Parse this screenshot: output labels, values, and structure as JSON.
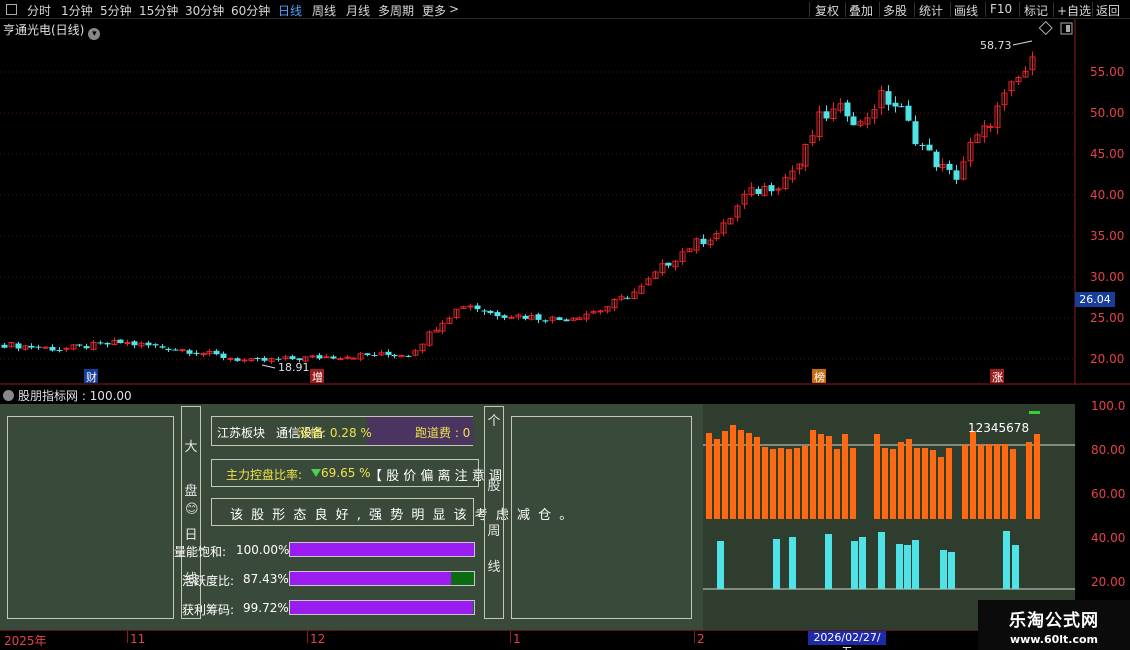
{
  "toolbar": {
    "left": [
      "分时",
      "1分钟",
      "5分钟",
      "15分钟",
      "30分钟",
      "60分钟",
      "日线",
      "周线",
      "月线",
      "多周期",
      "更多"
    ],
    "more_arrow": ">",
    "right": [
      "复权",
      "叠加",
      "多股",
      "统计",
      "画线",
      "F10",
      "标记",
      "+自选",
      "返回"
    ]
  },
  "main": {
    "title": "亨通光电(日线)",
    "high_label": "58.73",
    "low_label": "18.91",
    "last_price": "26.04",
    "yaxis": [
      "55.00",
      "50.00",
      "45.00",
      "40.00",
      "35.00",
      "30.00",
      "25.00",
      "20.00"
    ],
    "markers": [
      "财",
      "增",
      "榜",
      "涨"
    ],
    "up_color": "#e8232b",
    "down_color": "#4fe3e8"
  },
  "indicator": {
    "title": "股朋指标网 : 100.00",
    "left_vertical": [
      "大",
      "盘",
      "日",
      "线"
    ],
    "mid_vertical": [
      "个",
      "股",
      "周",
      "线"
    ],
    "sector": "江苏板块",
    "sector_sub": "通信设备",
    "change": "涨幅: 0.28 %",
    "runway": "跑道费 : 0",
    "control_label": "主力控盘比率:",
    "control_value": "69.65 %",
    "control_note": "【 股 价 偏 离 注 意 调",
    "trend_note": "该 股 形 态 良 好 , 强 势 明 显 该 考 虑 减 仓 。",
    "bars": [
      {
        "label": "量能饱和:",
        "value": "100.00%",
        "pct": 100
      },
      {
        "label": "活跃度比:",
        "value": "87.43%",
        "pct": 87.43
      },
      {
        "label": "获利筹码:",
        "value": "99.72%",
        "pct": 99.72
      }
    ],
    "digits": "12345678",
    "yaxis": [
      "100.0",
      "80.00",
      "60.00",
      "40.00",
      "20.00"
    ]
  },
  "timeaxis": {
    "labels": [
      "2025年",
      "11",
      "12",
      "1",
      "2"
    ],
    "date_box": "2026/02/27/五"
  },
  "watermark": {
    "line1": "乐淘公式网",
    "line2": "www.60lt.com"
  }
}
